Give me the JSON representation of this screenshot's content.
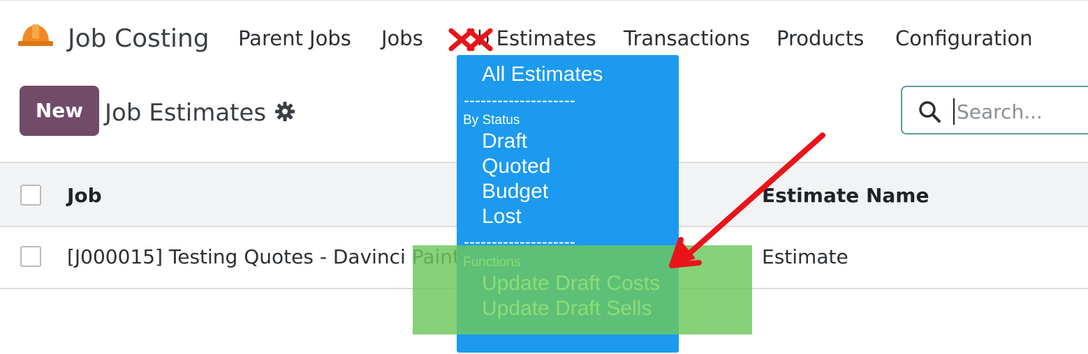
{
  "app": {
    "title": "Job Costing",
    "icon": "hard-hat-icon"
  },
  "nav": {
    "items": [
      {
        "label": "Parent Jobs"
      },
      {
        "label": "Jobs"
      },
      {
        "label": "Job Estimates"
      },
      {
        "label": "Transactions"
      },
      {
        "label": "Products"
      },
      {
        "label": "Configuration"
      }
    ],
    "estimates_label_visible": "b Estimates"
  },
  "control_panel": {
    "new_label": "New",
    "breadcrumb": "Job Estimates",
    "gear_icon": "gear-icon",
    "search_placeholder": "Search..."
  },
  "table": {
    "headers": {
      "job": "Job",
      "estimate_name": "Estimate Name"
    },
    "rows": [
      {
        "job": "[J000015] Testing Quotes - Davinci Paint",
        "estimate_name": "Estimate"
      }
    ]
  },
  "dropdown": {
    "all_estimates": "All Estimates",
    "separator": "--------------------",
    "by_status_label": "By Status",
    "status_items": [
      "Draft",
      "Quoted",
      "Budget",
      "Lost"
    ],
    "functions_label": "Functions",
    "function_items": [
      "Update Draft Costs",
      "Update Draft Sells"
    ]
  },
  "colors": {
    "brand": "#714b67",
    "dropdown_bg": "#1b9af0",
    "highlight": "#6cc85a",
    "function_text": "#8ddc76",
    "annotation_red": "#e8141a",
    "search_border": "#5a9aa0"
  }
}
